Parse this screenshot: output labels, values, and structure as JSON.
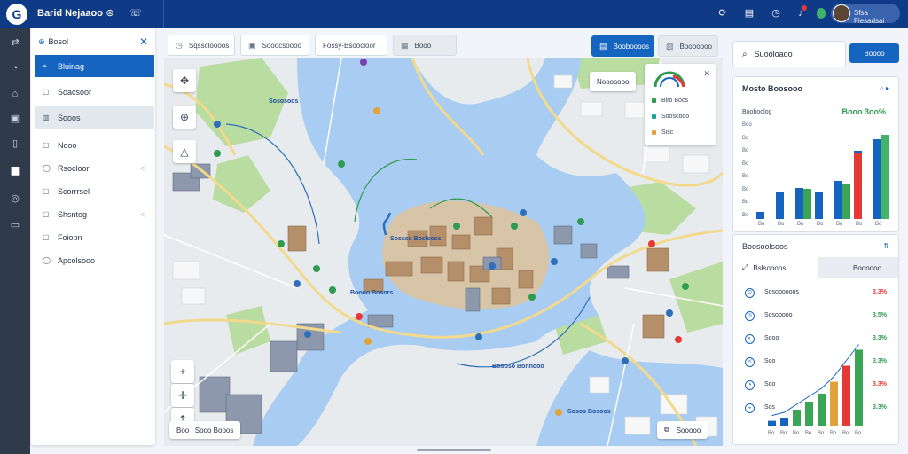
{
  "app": {
    "title": "Barid Nejaaoo"
  },
  "header": {
    "user_name": "Sfsa Fiesadsai"
  },
  "sidebar": {
    "title": "Bosol",
    "items": [
      {
        "label": "Bluinag",
        "icon": "pin-icon",
        "active": true
      },
      {
        "label": "Soacsoor",
        "icon": "square-icon"
      },
      {
        "label": "Sooos",
        "icon": "doc-icon",
        "hover": true
      },
      {
        "label": "Nooo",
        "icon": "square-icon"
      },
      {
        "label": "Rsocloor",
        "icon": "circle-icon",
        "tail": "◁"
      },
      {
        "label": "Scorrrsel",
        "icon": "square-icon"
      },
      {
        "label": "Shsntog",
        "icon": "square-icon",
        "tail": "◁"
      },
      {
        "label": "Foiopn",
        "icon": "square-icon"
      },
      {
        "label": "Apcolsooo",
        "icon": "circle-icon"
      }
    ]
  },
  "map_tabs": [
    {
      "label": "Sqsscloooos",
      "icon": "clock-icon"
    },
    {
      "label": "Sooocsoooo",
      "icon": "image-icon"
    },
    {
      "label": "Fossy-Bsoocloor",
      "icon": ""
    },
    {
      "label": "Booo",
      "icon": "grid-icon",
      "grey": true
    },
    {
      "label": "Booboooos",
      "icon": "save-icon",
      "primary": true
    },
    {
      "label": "Booooooo",
      "icon": "layers-icon",
      "grey": true
    }
  ],
  "map": {
    "status_chip": "Nooosooo",
    "legend": [
      {
        "label": "Biro Bocs",
        "color": "#2e9b4f"
      },
      {
        "label": "Sooscooo",
        "color": "#1aa39a"
      },
      {
        "label": "Sisc",
        "color": "#e0a23a"
      }
    ],
    "labels": [
      "Sososoos",
      "Sossss Boslsoss",
      "Boooo Bosors",
      "Boooso Bonnooo",
      "Sosos Bosoos"
    ],
    "scale": "Boo  |  Sooo Booos",
    "layers_chip": "Sooooo"
  },
  "search": {
    "value": "Suooloaoo",
    "button": "Boooo"
  },
  "chart1": {
    "title": "Mosto Boosooo",
    "action": "⌂ ▸",
    "label": "Booboolog",
    "value": "Booo 3oo%",
    "yticks": [
      "Boo",
      "Bo",
      "Bo",
      "Bo",
      "Bo",
      "Bo",
      "Bo",
      "Bo"
    ]
  },
  "chart_data": [
    {
      "type": "bar",
      "series": [
        {
          "values": [
            8,
            30,
            35,
            30,
            43,
            77,
            90
          ],
          "color": "#1565c0"
        },
        {
          "values": [
            0,
            0,
            34,
            0,
            40,
            0,
            0
          ],
          "color": "#3aa655"
        },
        {
          "values": [
            0,
            0,
            0,
            0,
            0,
            74,
            0
          ],
          "color": "#e53935"
        },
        {
          "values": [
            0,
            0,
            0,
            0,
            0,
            0,
            95
          ],
          "color": "#43b36b"
        }
      ],
      "xticks": [
        "Bo",
        "Bo",
        "Bo",
        "Bo",
        "Bo",
        "Bo",
        "Bo"
      ],
      "ylim": [
        0,
        100
      ]
    },
    {
      "type": "bar",
      "values": [
        6,
        10,
        20,
        30,
        40,
        55,
        75,
        95
      ],
      "xticks": [
        "Bo",
        "Bo",
        "Bo",
        "Bo",
        "Bo",
        "Bo",
        "Bo",
        "Bo"
      ],
      "ylim": [
        0,
        100
      ]
    }
  ],
  "panel2": {
    "title": "Boosoolsoos",
    "action": "⇅",
    "tabs": [
      "Bslsoooos",
      "Boooooo"
    ],
    "rows": [
      {
        "label": "Sosoboooos",
        "value": "3.3%",
        "color": "#e53935"
      },
      {
        "label": "Sosooooo",
        "value": "3.5%",
        "color": "#2e9b4f"
      },
      {
        "label": "Sooo",
        "value": "3.3%",
        "color": "#2e9b4f"
      },
      {
        "label": "Soo",
        "value": "3.3%",
        "color": "#2e9b4f"
      },
      {
        "label": "Soo",
        "value": "3.3%",
        "color": "#e53935"
      },
      {
        "label": "Sos",
        "value": "3.3%",
        "color": "#2e9b4f"
      }
    ]
  }
}
